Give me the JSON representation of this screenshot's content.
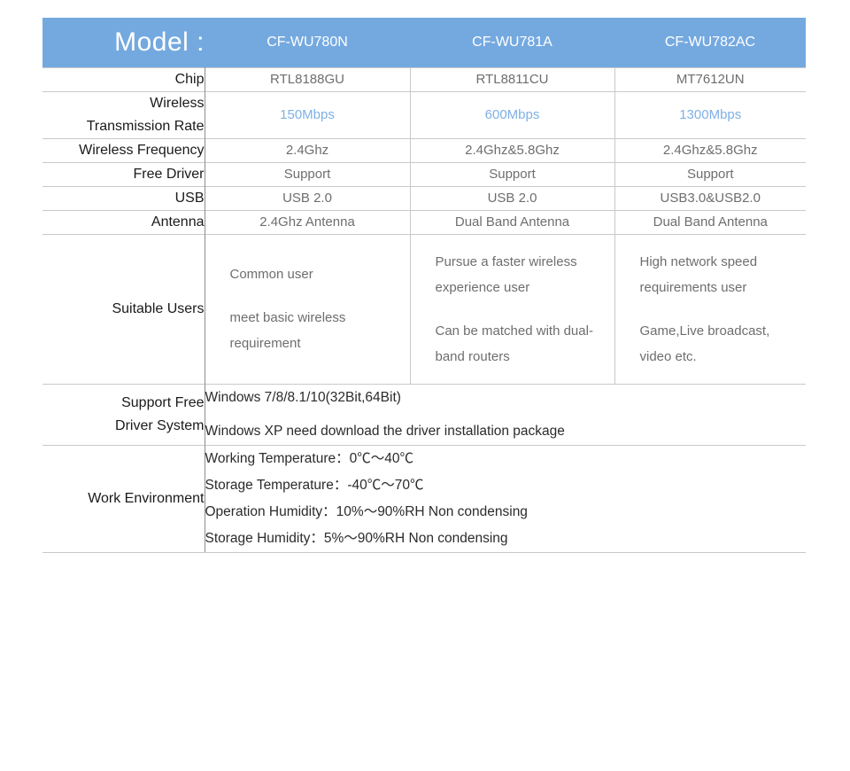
{
  "header": {
    "label": "Model :",
    "models": [
      "CF-WU780N",
      "CF-WU781A",
      "CF-WU782AC"
    ],
    "bg_color": "#74a9e0",
    "text_color": "#ffffff"
  },
  "accent_color": "#7fb0e4",
  "rows": [
    {
      "label": "Chip",
      "values": [
        "RTL8188GU",
        "RTL8811CU",
        "MT7612UN"
      ]
    },
    {
      "label": "Wireless Transmission Rate",
      "label_lines": [
        "Wireless",
        "Transmission Rate"
      ],
      "values": [
        "150Mbps",
        "600Mbps",
        "1300Mbps"
      ],
      "highlight": true
    },
    {
      "label": "Wireless Frequency",
      "values": [
        "2.4Ghz",
        "2.4Ghz&5.8Ghz",
        "2.4Ghz&5.8Ghz"
      ]
    },
    {
      "label": "Free Driver",
      "values": [
        "Support",
        "Support",
        "Support"
      ]
    },
    {
      "label": "USB",
      "values": [
        "USB 2.0",
        "USB 2.0",
        "USB3.0&USB2.0"
      ]
    },
    {
      "label": "Antenna",
      "values": [
        "2.4Ghz Antenna",
        "Dual Band Antenna",
        "Dual Band Antenna"
      ]
    }
  ],
  "suitable_users": {
    "label": "Suitable Users",
    "columns": [
      [
        "Common user",
        "meet basic wireless requirement"
      ],
      [
        "Pursue a faster wireless experience user",
        "Can be matched with dual-band routers"
      ],
      [
        "High network speed requirements user",
        "Game,Live broadcast, video etc."
      ]
    ]
  },
  "support_driver_system": {
    "label": "Support Free Driver System",
    "label_lines": [
      "Support Free",
      "Driver System"
    ],
    "lines": [
      "Windows 7/8/8.1/10(32Bit,64Bit)",
      "Windows XP need download the driver installation package"
    ]
  },
  "work_environment": {
    "label": "Work Environment",
    "lines": [
      "Working Temperature：0℃〜40℃",
      "Storage Temperature：-40℃〜70℃",
      "Operation Humidity：10%〜90%RH Non condensing",
      "Storage Humidity：5%〜90%RH Non condensing"
    ]
  }
}
